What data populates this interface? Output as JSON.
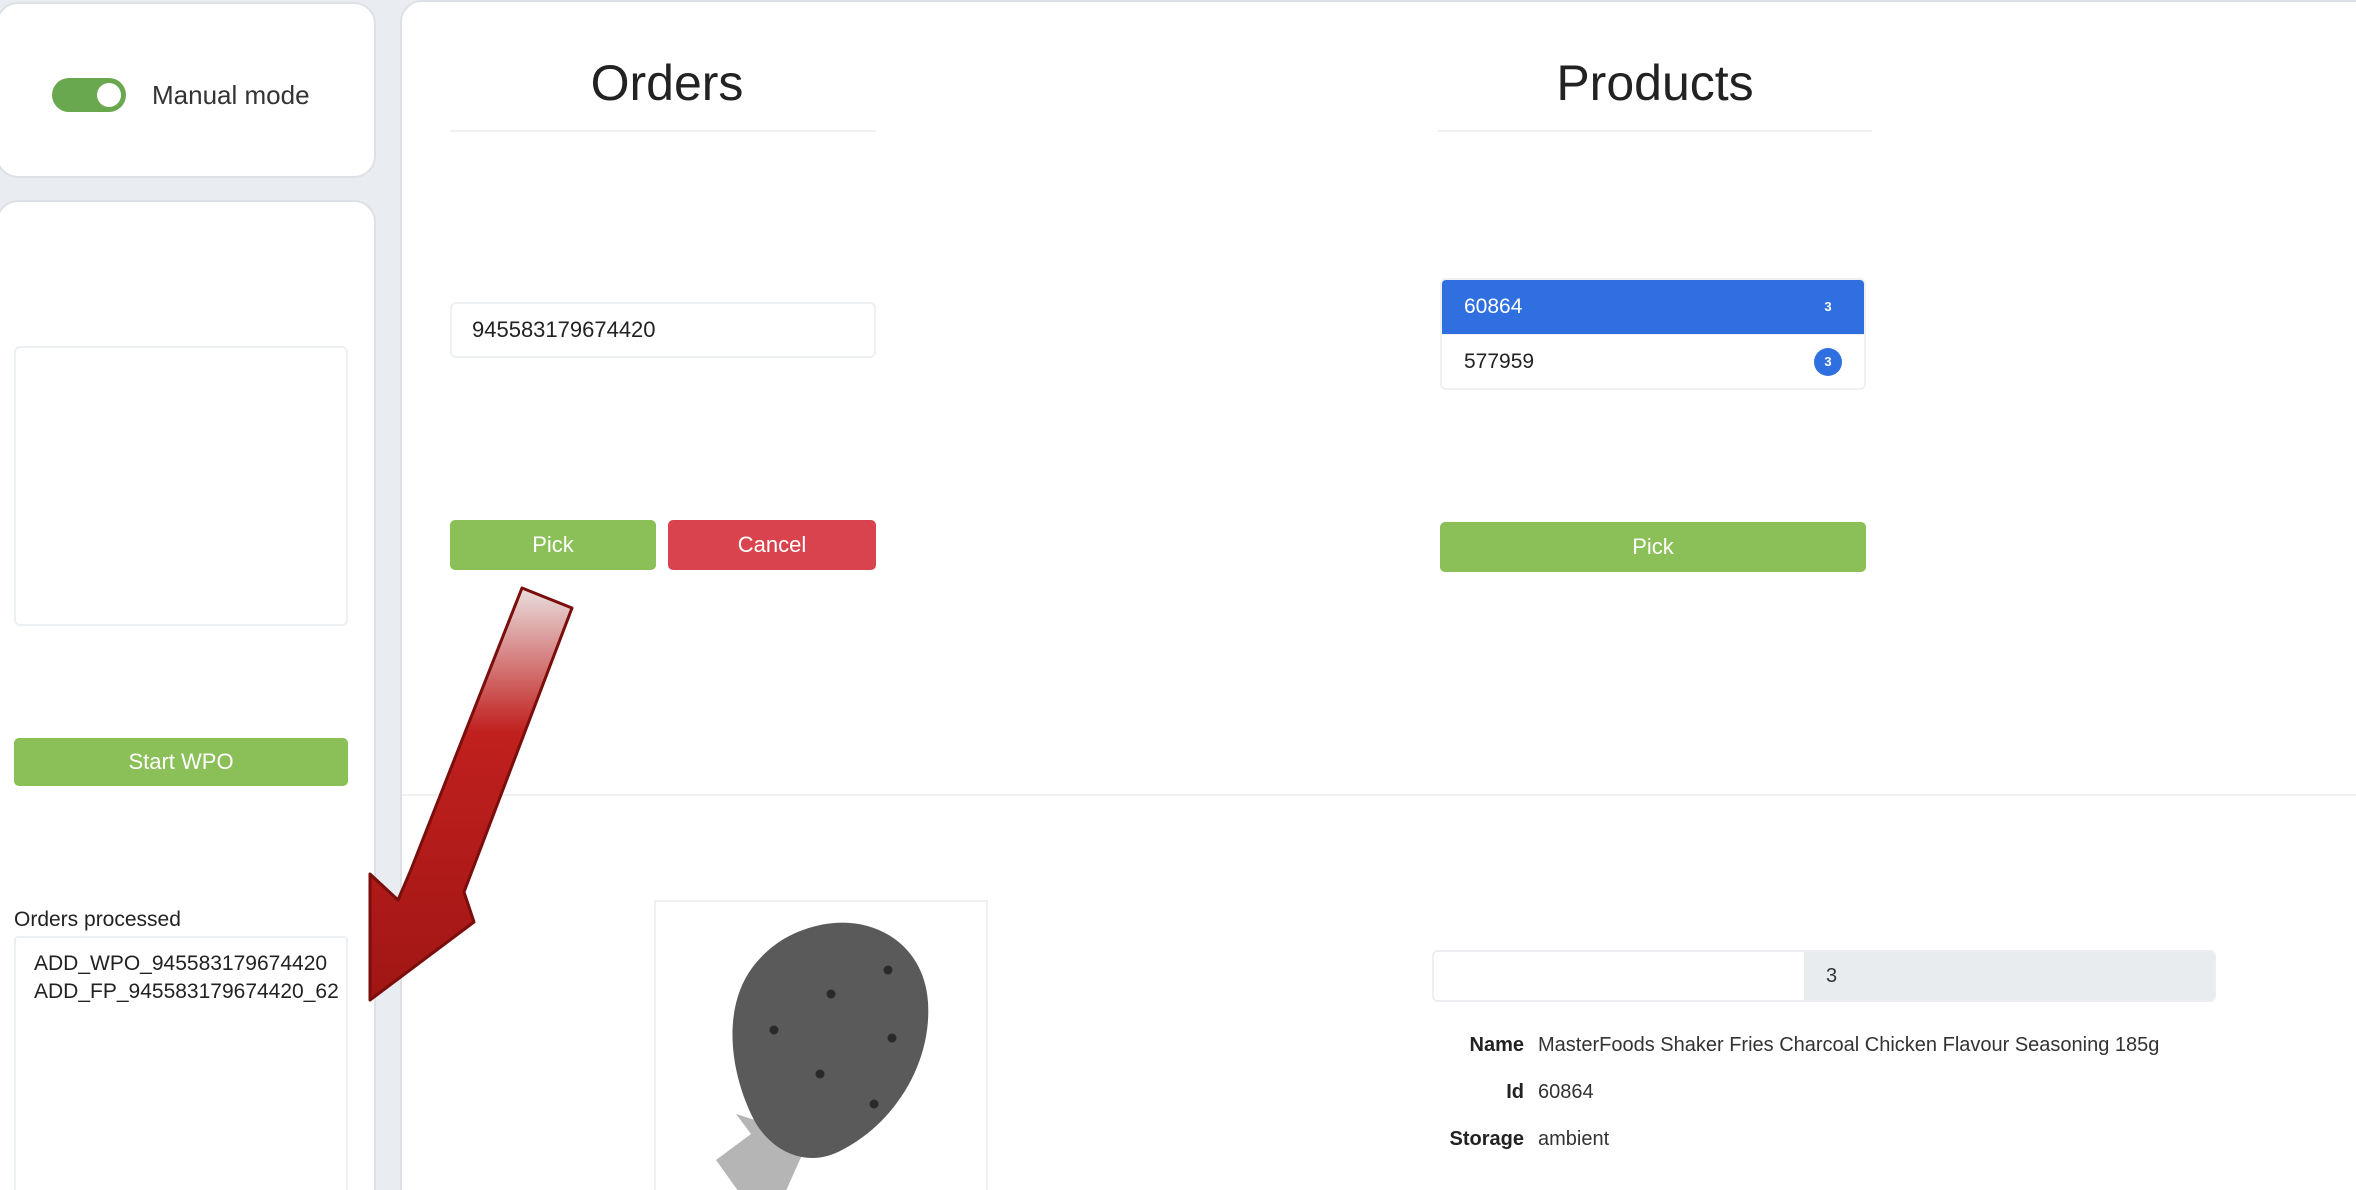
{
  "sidebar": {
    "manual_mode": {
      "label": "Manual mode",
      "enabled": true
    },
    "start_wpo_label": "Start WPO",
    "orders_processed": {
      "label": "Orders processed",
      "items": [
        "ADD_WPO_945583179674420",
        "ADD_FP_945583179674420_62"
      ]
    }
  },
  "orders": {
    "title": "Orders",
    "order_id_value": "945583179674420",
    "pick_label": "Pick",
    "cancel_label": "Cancel"
  },
  "products": {
    "title": "Products",
    "items": [
      {
        "id": "60864",
        "count": "3",
        "selected": true
      },
      {
        "id": "577959",
        "count": "3",
        "selected": false
      }
    ],
    "pick_label": "Pick"
  },
  "product_detail": {
    "image_icon": "strawberry-icon",
    "quantity_input_value": "",
    "quantity": "3",
    "name_label": "Name",
    "name": "MasterFoods Shaker Fries Charcoal Chicken Flavour Seasoning 185g",
    "id_label": "Id",
    "id": "60864",
    "storage_label": "Storage",
    "storage": "ambient"
  },
  "colors": {
    "accent_blue": "#2f6fe0",
    "button_green": "#8bbf57",
    "button_red": "#d9434e",
    "toggle_green": "#6aa84f",
    "annotation_arrow": "#c0201e"
  }
}
